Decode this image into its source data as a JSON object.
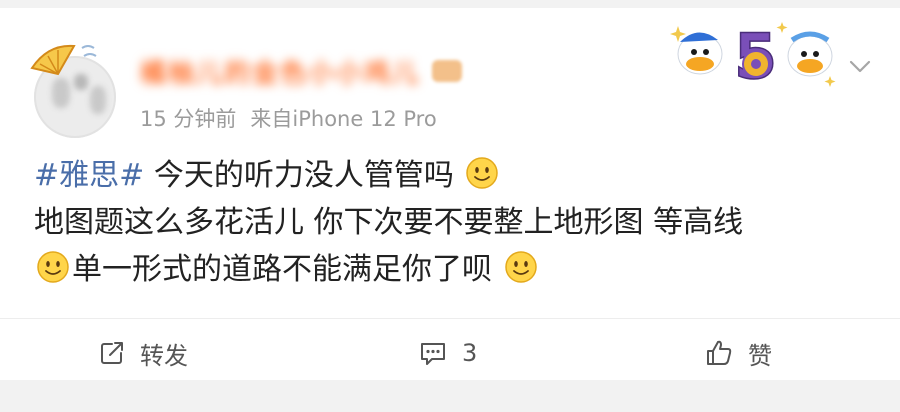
{
  "post": {
    "author_name": "橘柚儿的金色小小鸡儿",
    "time": "15 分钟前",
    "source": "来自iPhone 12 Pro",
    "hashtag": "#雅思#",
    "line1_text": " 今天的听力没人管管吗",
    "line2_text": "地图题这么多花活儿 你下次要不要整上地形图 等高线",
    "line3_text": "单一形式的道路不能满足你了呗"
  },
  "actions": {
    "repost_label": "转发",
    "comment_count": "3",
    "like_label": "赞"
  },
  "icons": {
    "more": "chevron-down-icon",
    "repost": "share-icon",
    "comment": "comment-icon",
    "like": "thumbs-up-icon",
    "emoji": "smile-emoji"
  },
  "colors": {
    "hashtag": "#4a6ea9",
    "meta_text": "#9b9b9b",
    "background": "#f2f2f2"
  }
}
